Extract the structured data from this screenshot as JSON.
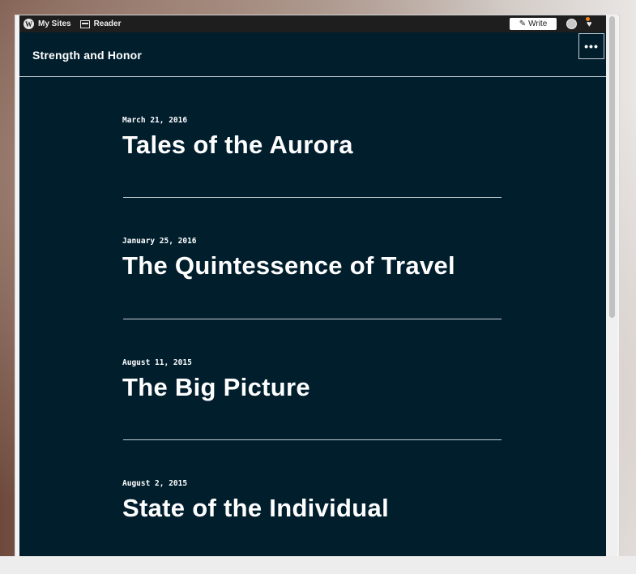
{
  "adminbar": {
    "my_sites_label": "My Sites",
    "reader_label": "Reader",
    "write_label": "Write"
  },
  "site": {
    "title": "Strength and Honor",
    "menu_glyph": "•••"
  },
  "posts": [
    {
      "date": "March 21, 2016",
      "title": "Tales of the Aurora"
    },
    {
      "date": "January 25, 2016",
      "title": "The Quintessence of Travel"
    },
    {
      "date": "August 11, 2015",
      "title": "The Big Picture"
    },
    {
      "date": "August 2, 2015",
      "title": "State of the Individual"
    }
  ],
  "colors": {
    "site_background": "#011e2d",
    "adminbar": "#1e1e1e",
    "notification_dot": "#f0821e"
  },
  "icons": [
    "wordpress-logo-icon",
    "reader-icon",
    "pencil-icon",
    "avatar-icon",
    "notifications-icon",
    "ellipsis-icon"
  ]
}
